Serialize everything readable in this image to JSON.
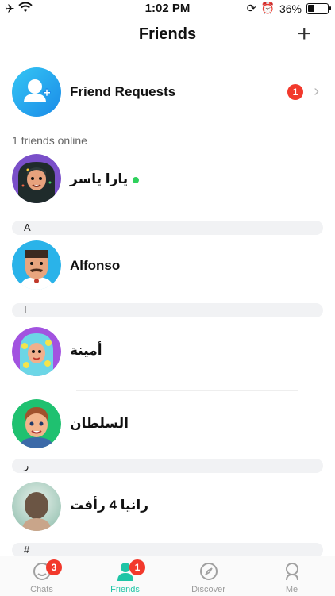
{
  "status_bar": {
    "time": "1:02 PM",
    "battery": "36%",
    "battery_level": 0.36
  },
  "nav": {
    "title": "Friends",
    "add_label": "+"
  },
  "friend_requests": {
    "label": "Friend Requests",
    "count": "1"
  },
  "online_text": "1 friends online",
  "online_friend": {
    "name": "يارا ياسر"
  },
  "sections": [
    {
      "letter": "A",
      "friends": [
        {
          "name": "Alfonso"
        }
      ]
    },
    {
      "letter": "ا",
      "friends": [
        {
          "name": "أمينة"
        },
        {
          "name": "السلطان"
        }
      ]
    },
    {
      "letter": "ر",
      "friends": [
        {
          "name": "رانيا 4 رأفت"
        }
      ]
    },
    {
      "letter": "#",
      "friends": []
    }
  ],
  "tabs": [
    {
      "label": "Chats",
      "badge": "3"
    },
    {
      "label": "Friends",
      "badge": "1"
    },
    {
      "label": "Discover",
      "badge": ""
    },
    {
      "label": "Me",
      "badge": ""
    }
  ],
  "colors": {
    "accent": "#1fc5a6",
    "badge": "#f2392c",
    "online": "#2fd15c",
    "request_icon": "#1a8be8"
  }
}
